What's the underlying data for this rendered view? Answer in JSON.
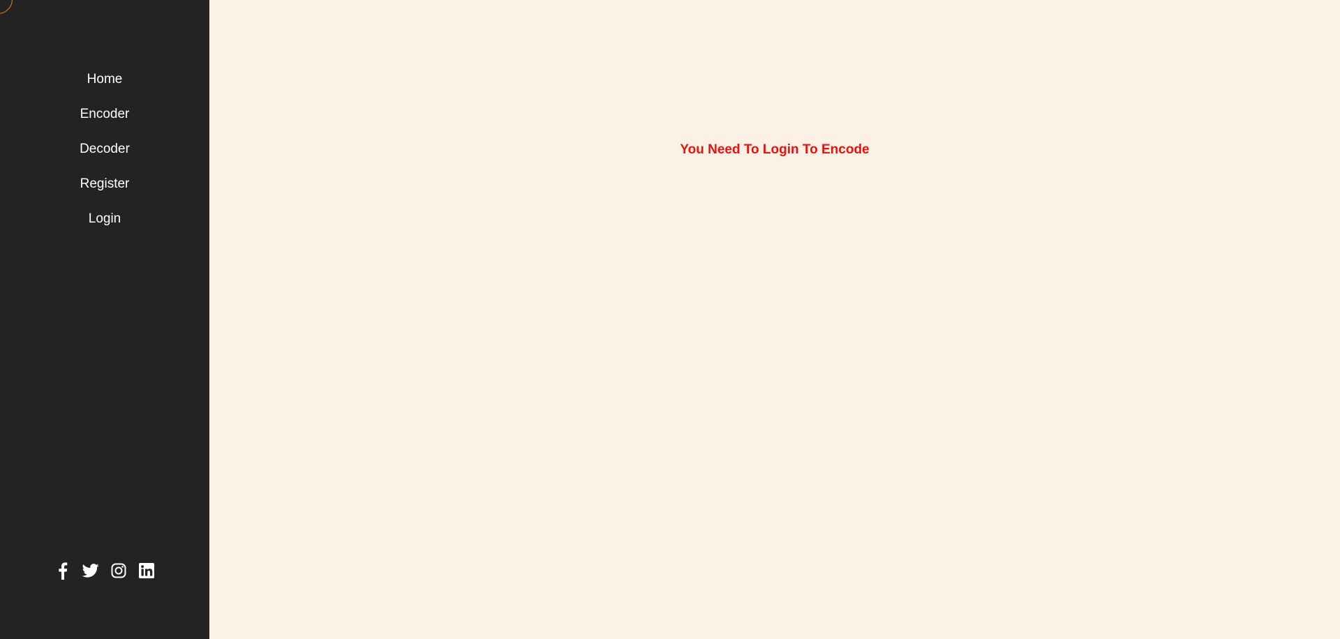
{
  "sidebar": {
    "logo": {
      "icon": "logo-circle-icon",
      "border_color": "#d9822b"
    },
    "nav": [
      {
        "label": "Home"
      },
      {
        "label": "Encoder"
      },
      {
        "label": "Decoder"
      },
      {
        "label": "Register"
      },
      {
        "label": "Login"
      }
    ],
    "social": [
      {
        "icon": "facebook-icon"
      },
      {
        "icon": "twitter-icon"
      },
      {
        "icon": "instagram-icon"
      },
      {
        "icon": "linkedin-icon"
      }
    ],
    "background": "#232323"
  },
  "main": {
    "message": "You Need To Login To Encode",
    "message_color": "#e8130f",
    "background": "#fcf1e6"
  }
}
